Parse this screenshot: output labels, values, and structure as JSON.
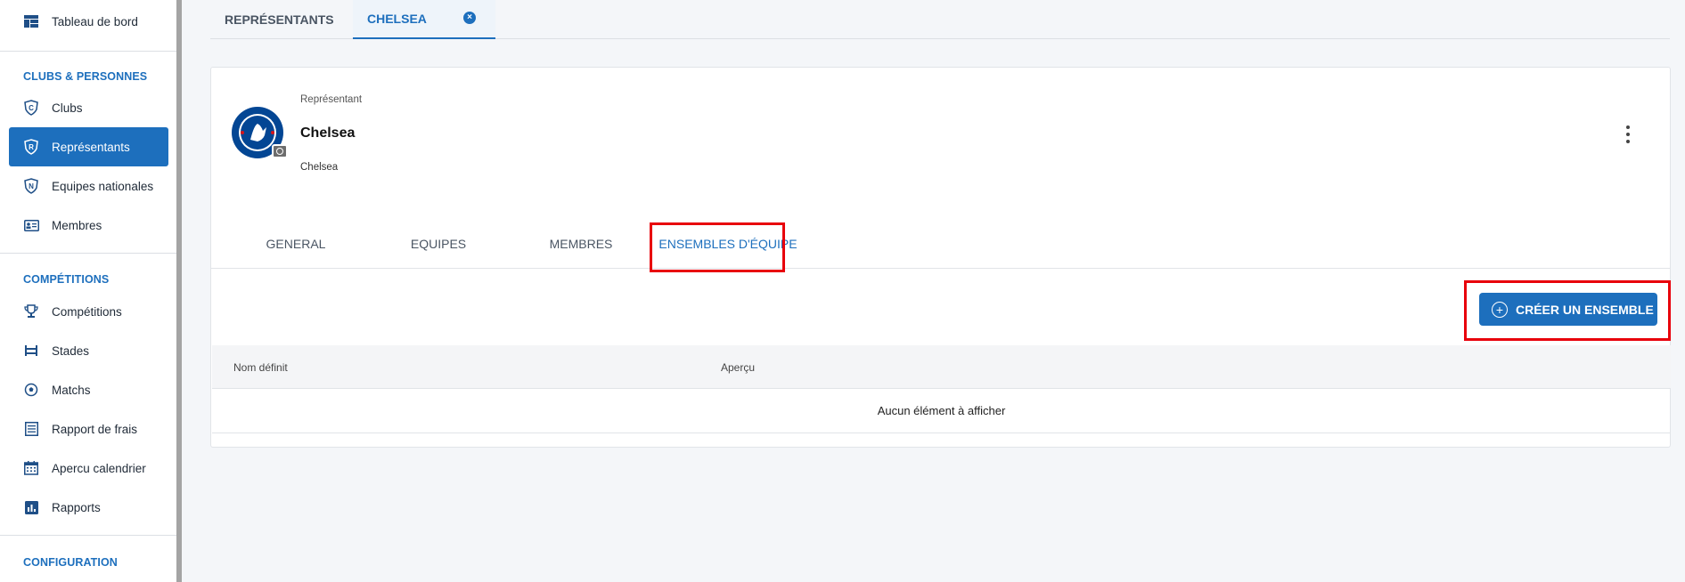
{
  "sidebar": {
    "items": [
      {
        "label": "Tableau de bord",
        "icon": "dashboard-icon"
      },
      {
        "label": "Clubs",
        "icon": "clubs-shield-icon"
      },
      {
        "label": "Représentants",
        "icon": "representative-shield-icon",
        "active": true
      },
      {
        "label": "Equipes nationales",
        "icon": "national-team-shield-icon"
      },
      {
        "label": "Membres",
        "icon": "id-card-icon"
      },
      {
        "label": "Compétitions",
        "icon": "trophy-icon"
      },
      {
        "label": "Stades",
        "icon": "stadium-icon"
      },
      {
        "label": "Matchs",
        "icon": "soccer-ball-icon"
      },
      {
        "label": "Rapport de frais",
        "icon": "list-icon"
      },
      {
        "label": "Apercu calendrier",
        "icon": "calendar-icon"
      },
      {
        "label": "Rapports",
        "icon": "bar-chart-icon"
      }
    ],
    "sections": {
      "clubs": "CLUBS & PERSONNES",
      "competitions": "COMPÉTITIONS",
      "config": "CONFIGURATION"
    }
  },
  "top_tabs": [
    {
      "label": "REPRÉSENTANTS"
    },
    {
      "label": "CHELSEA",
      "active": true
    }
  ],
  "profile": {
    "type_label": "Représentant",
    "name": "Chelsea",
    "secondary_name": "Chelsea"
  },
  "inner_tabs": [
    {
      "label": "GENERAL"
    },
    {
      "label": "EQUIPES"
    },
    {
      "label": "MEMBRES"
    },
    {
      "label": "ENSEMBLES D'ÉQUIPE",
      "active": true
    }
  ],
  "create_button": "CRÉER UN ENSEMBLE",
  "table": {
    "columns": [
      "Nom définit",
      "Aperçu"
    ],
    "empty_message": "Aucun élément à afficher"
  },
  "colors": {
    "accent": "#1d6fbd",
    "highlight": "#e8000b"
  }
}
